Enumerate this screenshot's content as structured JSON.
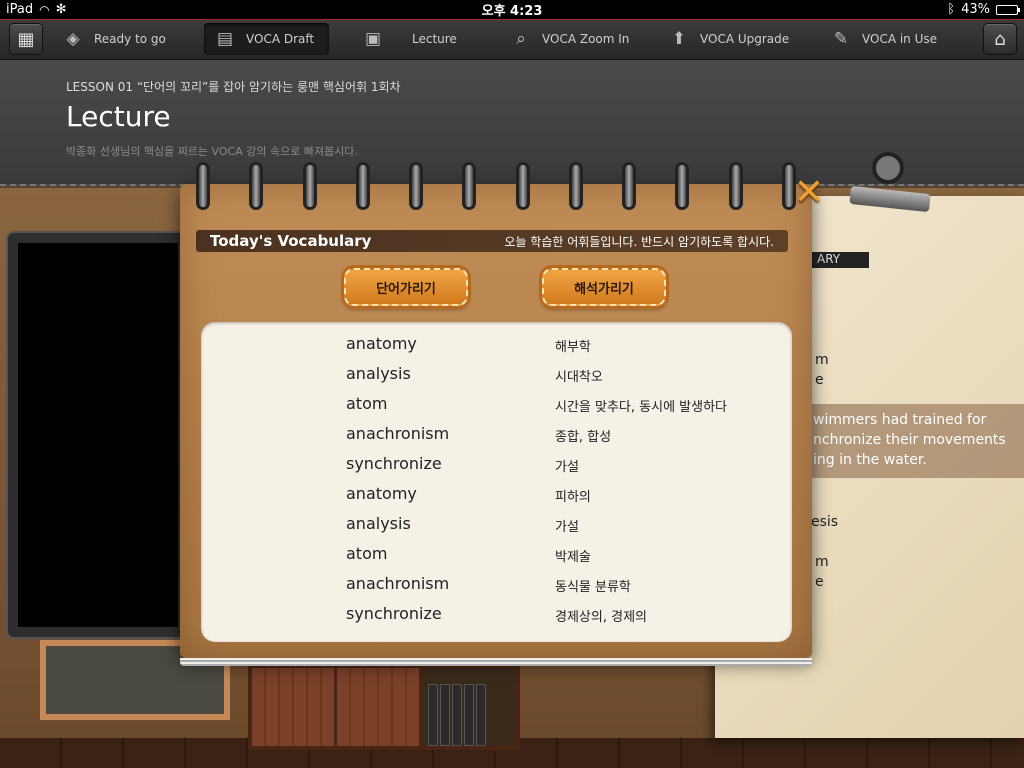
{
  "status_bar": {
    "device": "iPad",
    "time": "오후 4:23",
    "battery": "43%",
    "battery_level": 0.43
  },
  "toolbar": {
    "items": [
      {
        "label": "Ready to go",
        "icon": "cube-icon"
      },
      {
        "label": "VOCA Draft",
        "icon": "document-icon",
        "active": true
      },
      {
        "label": "Lecture",
        "icon": "slides-icon"
      },
      {
        "label": "VOCA Zoom In",
        "icon": "magnifier-icon"
      },
      {
        "label": "VOCA Upgrade",
        "icon": "upgrade-icon"
      },
      {
        "label": "VOCA in Use",
        "icon": "pencil-icon"
      }
    ]
  },
  "lesson": {
    "label": "LESSON 01 “단어의 꼬리”를 잡아 암기하는 룽맨 핵심어휘 1회차",
    "title": "Lecture",
    "description": "박종화 선생님의 핵심을 찌르는 VOCA 강의 속으로 빠져봅시다."
  },
  "sheet": {
    "bar_label": "ARY",
    "words": [
      "m",
      "e",
      "esis",
      "m",
      "e"
    ],
    "box_text": "wimmers had trained for nchronize their movements ing in the water."
  },
  "vocab": {
    "title": "Today's Vocabulary",
    "subtitle": "오늘 학습한 어휘들입니다. 반드시 암기하도록 합시다.",
    "hide_words_label": "단어가리기",
    "hide_meanings_label": "해석가리기",
    "rows": [
      {
        "word": "anatomy",
        "meaning": "해부학"
      },
      {
        "word": "analysis",
        "meaning": "시대착오"
      },
      {
        "word": "atom",
        "meaning": "시간을 맞추다, 동시에 발생하다"
      },
      {
        "word": "anachronism",
        "meaning": "종합, 합성"
      },
      {
        "word": "synchronize",
        "meaning": "가설"
      },
      {
        "word": "anatomy",
        "meaning": "피하의"
      },
      {
        "word": "analysis",
        "meaning": "가설"
      },
      {
        "word": "atom",
        "meaning": "박제술"
      },
      {
        "word": "anachronism",
        "meaning": "동식물 분류학"
      },
      {
        "word": "synchronize",
        "meaning": "경제상의, 경제의"
      }
    ]
  }
}
